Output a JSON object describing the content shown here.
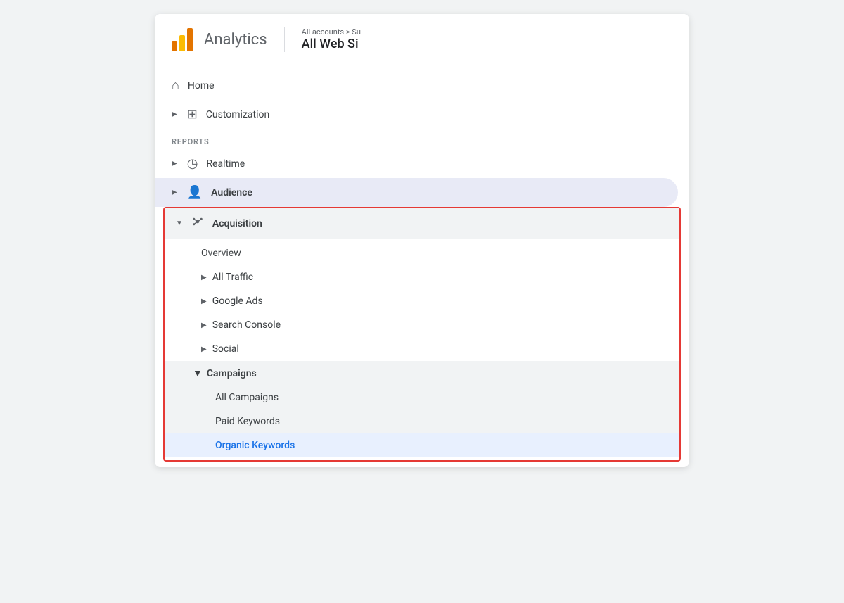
{
  "header": {
    "title": "Analytics",
    "breadcrumb_top": "All accounts > Su",
    "breadcrumb_main": "All Web Si"
  },
  "sidebar": {
    "reports_label": "REPORTS",
    "items": [
      {
        "id": "home",
        "label": "Home",
        "icon": "🏠",
        "has_chevron": false
      },
      {
        "id": "customization",
        "label": "Customization",
        "icon": "⊞",
        "has_chevron": true
      },
      {
        "id": "realtime",
        "label": "Realtime",
        "icon": "⏱",
        "has_chevron": true
      },
      {
        "id": "audience",
        "label": "Audience",
        "icon": "👤",
        "has_chevron": true,
        "active": true
      }
    ],
    "acquisition": {
      "label": "Acquisition",
      "icon": "⊕",
      "sub_items": [
        {
          "id": "overview",
          "label": "Overview",
          "has_chevron": false
        },
        {
          "id": "all-traffic",
          "label": "All Traffic",
          "has_chevron": true
        },
        {
          "id": "google-ads",
          "label": "Google Ads",
          "has_chevron": true
        },
        {
          "id": "search-console",
          "label": "Search Console",
          "has_chevron": true
        },
        {
          "id": "social",
          "label": "Social",
          "has_chevron": true
        }
      ],
      "campaigns": {
        "label": "Campaigns",
        "sub_items": [
          {
            "id": "all-campaigns",
            "label": "All Campaigns"
          },
          {
            "id": "paid-keywords",
            "label": "Paid Keywords"
          },
          {
            "id": "organic-keywords",
            "label": "Organic Keywords",
            "active": true
          }
        ]
      }
    }
  }
}
